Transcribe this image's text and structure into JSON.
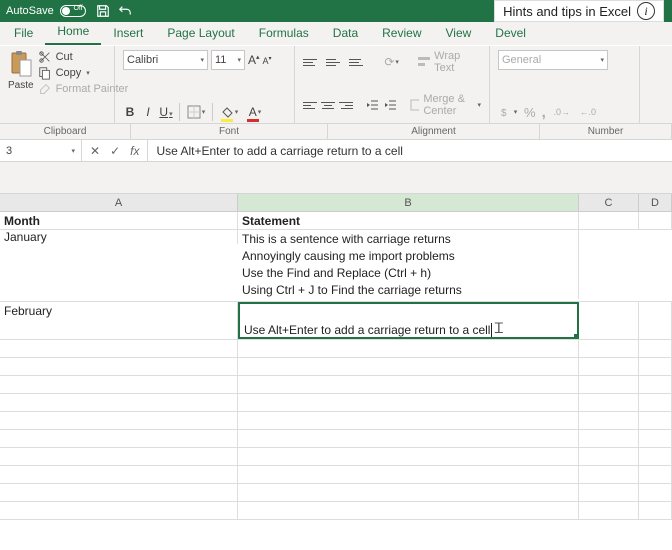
{
  "titlebar": {
    "autosave": "AutoSave",
    "toggle": "Off"
  },
  "hint": {
    "text": "Hints and tips in Excel",
    "info": "i"
  },
  "menu": {
    "file": "File",
    "home": "Home",
    "insert": "Insert",
    "page_layout": "Page Layout",
    "formulas": "Formulas",
    "data": "Data",
    "review": "Review",
    "view": "View",
    "developer": "Devel"
  },
  "ribbon": {
    "clipboard": {
      "paste": "Paste",
      "cut": "Cut",
      "copy": "Copy",
      "format_painter": "Format Painter",
      "label": "Clipboard"
    },
    "font": {
      "name": "Calibri",
      "size": "11",
      "label": "Font",
      "bold": "B",
      "italic": "I",
      "underline": "U",
      "fontA": "A"
    },
    "alignment": {
      "wrap": "Wrap Text",
      "merge": "Merge & Center",
      "label": "Alignment"
    },
    "number": {
      "general": "General",
      "pct": "%",
      "comma": ",",
      "label": "Number"
    }
  },
  "formula_bar": {
    "name_box": "3",
    "fx": "fx",
    "value": "Use Alt+Enter to add a carriage return to a cell"
  },
  "columns": {
    "A": "A",
    "B": "B",
    "C": "C",
    "D": "D"
  },
  "sheet": {
    "headers": {
      "month": "Month",
      "statement": "Statement"
    },
    "rows": [
      {
        "month": "January",
        "statement_lines": [
          "This is a sentence with carriage returns",
          "Annoyingly causing me import problems",
          "Use the Find and Replace (Ctrl + h)",
          "Using Ctrl + J to Find the carriage returns"
        ]
      },
      {
        "month": "February",
        "statement_editing": "Use Alt+Enter to add a carriage return to a cell"
      }
    ]
  }
}
